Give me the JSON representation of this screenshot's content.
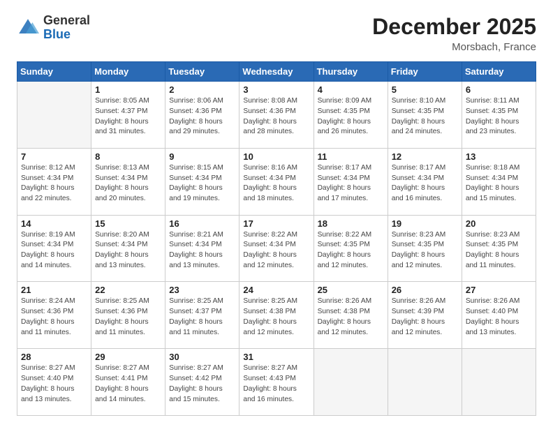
{
  "header": {
    "logo_general": "General",
    "logo_blue": "Blue",
    "month_title": "December 2025",
    "location": "Morsbach, France"
  },
  "weekdays": [
    "Sunday",
    "Monday",
    "Tuesday",
    "Wednesday",
    "Thursday",
    "Friday",
    "Saturday"
  ],
  "weeks": [
    [
      {
        "day": "",
        "info": ""
      },
      {
        "day": "1",
        "info": "Sunrise: 8:05 AM\nSunset: 4:37 PM\nDaylight: 8 hours\nand 31 minutes."
      },
      {
        "day": "2",
        "info": "Sunrise: 8:06 AM\nSunset: 4:36 PM\nDaylight: 8 hours\nand 29 minutes."
      },
      {
        "day": "3",
        "info": "Sunrise: 8:08 AM\nSunset: 4:36 PM\nDaylight: 8 hours\nand 28 minutes."
      },
      {
        "day": "4",
        "info": "Sunrise: 8:09 AM\nSunset: 4:35 PM\nDaylight: 8 hours\nand 26 minutes."
      },
      {
        "day": "5",
        "info": "Sunrise: 8:10 AM\nSunset: 4:35 PM\nDaylight: 8 hours\nand 24 minutes."
      },
      {
        "day": "6",
        "info": "Sunrise: 8:11 AM\nSunset: 4:35 PM\nDaylight: 8 hours\nand 23 minutes."
      }
    ],
    [
      {
        "day": "7",
        "info": "Sunrise: 8:12 AM\nSunset: 4:34 PM\nDaylight: 8 hours\nand 22 minutes."
      },
      {
        "day": "8",
        "info": "Sunrise: 8:13 AM\nSunset: 4:34 PM\nDaylight: 8 hours\nand 20 minutes."
      },
      {
        "day": "9",
        "info": "Sunrise: 8:15 AM\nSunset: 4:34 PM\nDaylight: 8 hours\nand 19 minutes."
      },
      {
        "day": "10",
        "info": "Sunrise: 8:16 AM\nSunset: 4:34 PM\nDaylight: 8 hours\nand 18 minutes."
      },
      {
        "day": "11",
        "info": "Sunrise: 8:17 AM\nSunset: 4:34 PM\nDaylight: 8 hours\nand 17 minutes."
      },
      {
        "day": "12",
        "info": "Sunrise: 8:17 AM\nSunset: 4:34 PM\nDaylight: 8 hours\nand 16 minutes."
      },
      {
        "day": "13",
        "info": "Sunrise: 8:18 AM\nSunset: 4:34 PM\nDaylight: 8 hours\nand 15 minutes."
      }
    ],
    [
      {
        "day": "14",
        "info": "Sunrise: 8:19 AM\nSunset: 4:34 PM\nDaylight: 8 hours\nand 14 minutes."
      },
      {
        "day": "15",
        "info": "Sunrise: 8:20 AM\nSunset: 4:34 PM\nDaylight: 8 hours\nand 13 minutes."
      },
      {
        "day": "16",
        "info": "Sunrise: 8:21 AM\nSunset: 4:34 PM\nDaylight: 8 hours\nand 13 minutes."
      },
      {
        "day": "17",
        "info": "Sunrise: 8:22 AM\nSunset: 4:34 PM\nDaylight: 8 hours\nand 12 minutes."
      },
      {
        "day": "18",
        "info": "Sunrise: 8:22 AM\nSunset: 4:35 PM\nDaylight: 8 hours\nand 12 minutes."
      },
      {
        "day": "19",
        "info": "Sunrise: 8:23 AM\nSunset: 4:35 PM\nDaylight: 8 hours\nand 12 minutes."
      },
      {
        "day": "20",
        "info": "Sunrise: 8:23 AM\nSunset: 4:35 PM\nDaylight: 8 hours\nand 11 minutes."
      }
    ],
    [
      {
        "day": "21",
        "info": "Sunrise: 8:24 AM\nSunset: 4:36 PM\nDaylight: 8 hours\nand 11 minutes."
      },
      {
        "day": "22",
        "info": "Sunrise: 8:25 AM\nSunset: 4:36 PM\nDaylight: 8 hours\nand 11 minutes."
      },
      {
        "day": "23",
        "info": "Sunrise: 8:25 AM\nSunset: 4:37 PM\nDaylight: 8 hours\nand 11 minutes."
      },
      {
        "day": "24",
        "info": "Sunrise: 8:25 AM\nSunset: 4:38 PM\nDaylight: 8 hours\nand 12 minutes."
      },
      {
        "day": "25",
        "info": "Sunrise: 8:26 AM\nSunset: 4:38 PM\nDaylight: 8 hours\nand 12 minutes."
      },
      {
        "day": "26",
        "info": "Sunrise: 8:26 AM\nSunset: 4:39 PM\nDaylight: 8 hours\nand 12 minutes."
      },
      {
        "day": "27",
        "info": "Sunrise: 8:26 AM\nSunset: 4:40 PM\nDaylight: 8 hours\nand 13 minutes."
      }
    ],
    [
      {
        "day": "28",
        "info": "Sunrise: 8:27 AM\nSunset: 4:40 PM\nDaylight: 8 hours\nand 13 minutes."
      },
      {
        "day": "29",
        "info": "Sunrise: 8:27 AM\nSunset: 4:41 PM\nDaylight: 8 hours\nand 14 minutes."
      },
      {
        "day": "30",
        "info": "Sunrise: 8:27 AM\nSunset: 4:42 PM\nDaylight: 8 hours\nand 15 minutes."
      },
      {
        "day": "31",
        "info": "Sunrise: 8:27 AM\nSunset: 4:43 PM\nDaylight: 8 hours\nand 16 minutes."
      },
      {
        "day": "",
        "info": ""
      },
      {
        "day": "",
        "info": ""
      },
      {
        "day": "",
        "info": ""
      }
    ]
  ]
}
